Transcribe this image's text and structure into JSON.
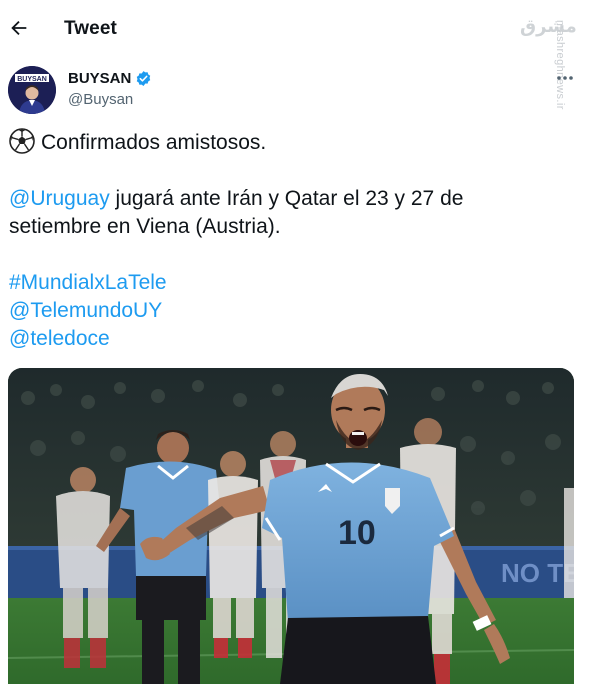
{
  "header": {
    "title": "Tweet",
    "back_icon": "arrow-left-icon"
  },
  "watermark": {
    "logo": "مشرق",
    "text": "mashreghnews.ir"
  },
  "author": {
    "name": "BUYSAN",
    "handle": "@Buysan",
    "avatar_text": "BUYSAN",
    "verified": true,
    "verified_color": "#1d9bf0"
  },
  "tweet": {
    "line1": "Confirmados amistosos.",
    "mention_uruguay": "@Uruguay",
    "line2_rest": " jugará ante Irán y Qatar el 23 y 27 de",
    "line3": "setiembre en Viena (Austria).",
    "hashtag": "#MundialxLaTele",
    "mention_telemundo": "@TelemundoUY",
    "mention_teledoce": "@teledoce",
    "link_color": "#1d9bf0"
  },
  "media": {
    "jersey_number": "10",
    "boards_text": "NO TE"
  }
}
